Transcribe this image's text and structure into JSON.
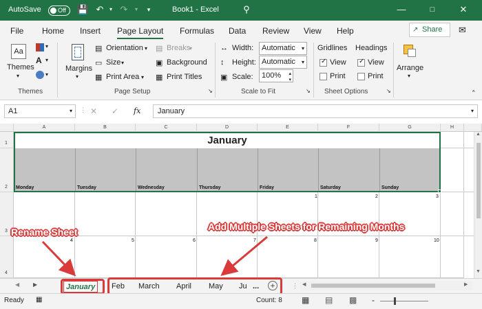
{
  "title_bar": {
    "autosave_label": "AutoSave",
    "toggle_label": "Off",
    "title": "Book1  -  Excel"
  },
  "menu": {
    "tabs": [
      "File",
      "Home",
      "Insert",
      "Page Layout",
      "Formulas",
      "Data",
      "Review",
      "View",
      "Help"
    ],
    "active_tab": "Page Layout",
    "share_label": "Share"
  },
  "ribbon": {
    "themes": {
      "button": "Themes",
      "group_label": "Themes"
    },
    "page_setup": {
      "margins": "Margins",
      "orientation": "Orientation",
      "size": "Size",
      "print_area": "Print Area",
      "breaks": "Breaks",
      "background": "Background",
      "print_titles": "Print Titles",
      "group_label": "Page Setup"
    },
    "scale_to_fit": {
      "width_label": "Width:",
      "width_value": "Automatic",
      "height_label": "Height:",
      "height_value": "Automatic",
      "scale_label": "Scale:",
      "scale_value": "100%",
      "group_label": "Scale to Fit"
    },
    "sheet_options": {
      "gridlines": "Gridlines",
      "headings": "Headings",
      "view": "View",
      "print": "Print",
      "group_label": "Sheet Options"
    },
    "arrange": {
      "button": "Arrange"
    }
  },
  "formula_bar": {
    "name_box": "A1",
    "fx_label": "fx",
    "formula": "January"
  },
  "grid": {
    "columns": [
      "A",
      "B",
      "C",
      "D",
      "E",
      "F",
      "G",
      "H"
    ],
    "rows": [
      "1",
      "2",
      "3",
      "4"
    ],
    "title": "January",
    "days": [
      "Monday",
      "Tuesday",
      "Wednesday",
      "Thursday",
      "Friday",
      "Saturday",
      "Sunday"
    ],
    "week1_numbers": [
      "1",
      "2",
      "3"
    ],
    "week2_numbers": [
      "4",
      "5",
      "6",
      "7",
      "8",
      "9",
      "10"
    ]
  },
  "annotations": {
    "rename": "Rename Sheet",
    "add": "Add Multiple Sheets for Remaining Months",
    "accent_color": "#d93a3a"
  },
  "sheet_tabs": {
    "active": "January",
    "others": [
      "Feb",
      "March",
      "April",
      "May",
      "Ju",
      "..."
    ]
  },
  "status_bar": {
    "ready": "Ready",
    "count": "Count: 8",
    "zoom_minus": "-"
  }
}
